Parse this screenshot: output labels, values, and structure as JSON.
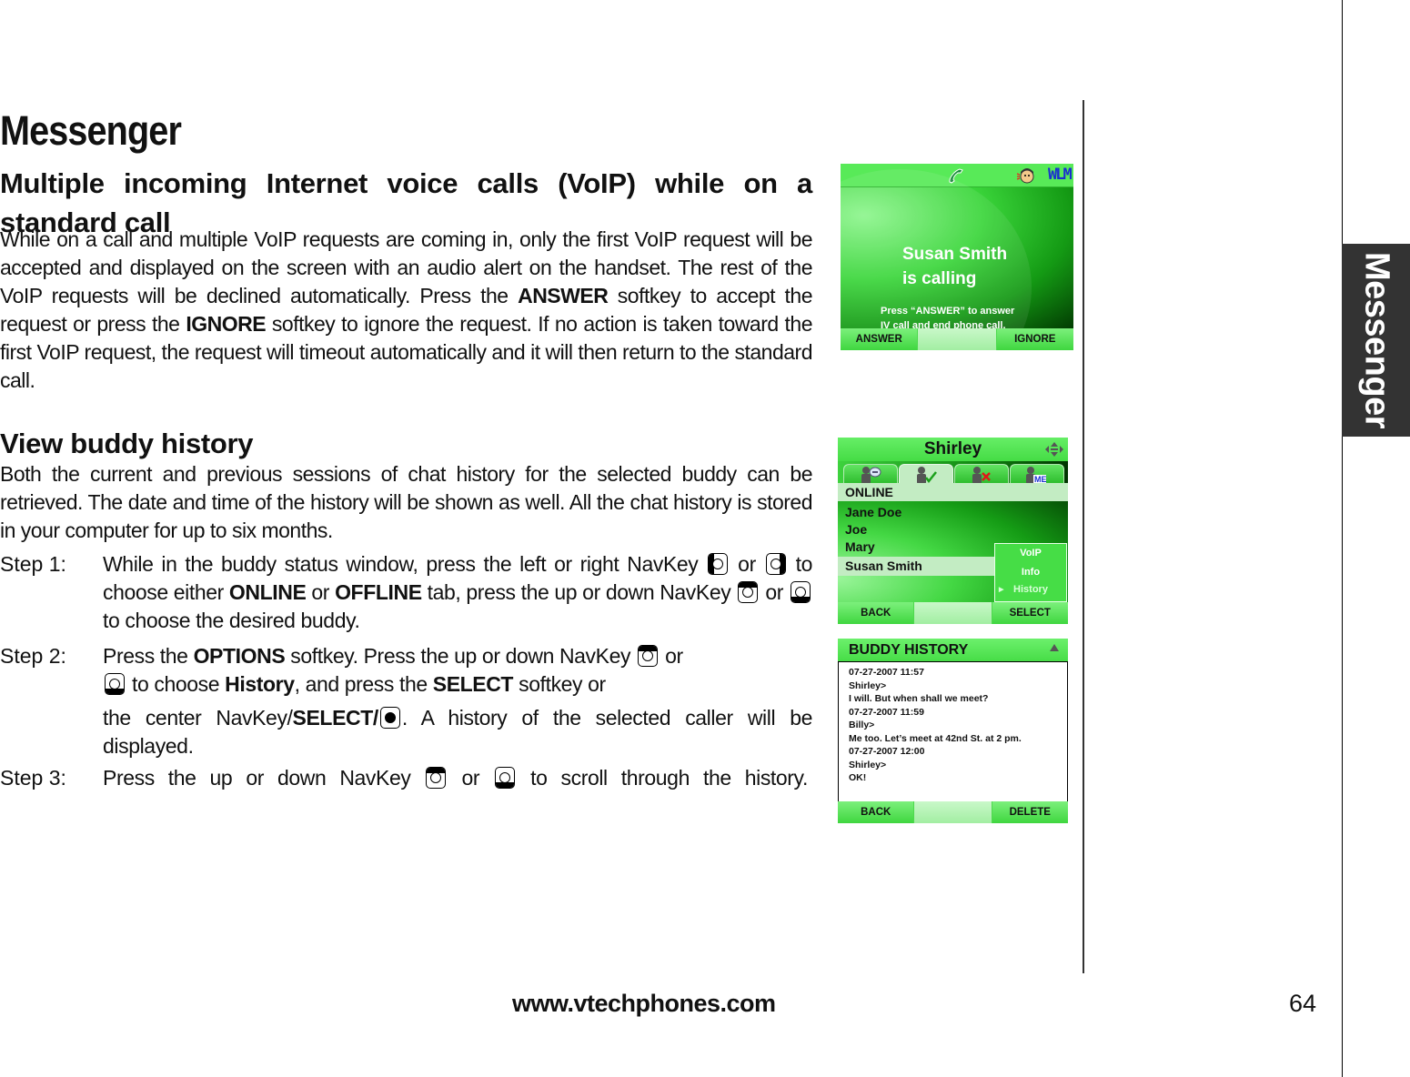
{
  "page": {
    "title": "Messenger",
    "side_tab": "Messenger",
    "footer_url": "www.vtechphones.com",
    "page_number": "64"
  },
  "section1": {
    "title": "Multiple incoming Internet voice calls (VoIP) while on a standard call",
    "para_parts": [
      "While on a call and multiple VoIP requests are coming in, only the first VoIP request will be accepted and displayed on the screen with an audio alert on the handset. The rest of the VoIP requests will be declined automatically. Press the ",
      "ANSWER",
      " softkey to accept the request or press the ",
      "IGNORE",
      " softkey to ignore the request. If no action is taken toward the first VoIP request, the request will timeout automatically and it will then return to the standard call."
    ]
  },
  "section2": {
    "title": "View buddy history",
    "para": "Both the current and previous sessions of chat history for the selected buddy can be retrieved. The date and time of the history will be shown as well. All the chat history is stored in your computer for up to six months.",
    "steps": [
      {
        "label": "Step 1:",
        "t1": "While in the buddy status window, press the left or right NavKey",
        "t2": "or",
        "t3": "to choose either",
        "b1": "ONLINE",
        "t4": "or",
        "b2": "OFFLINE",
        "t5": "tab, press the up or down NavKey",
        "t6": "or",
        "t7": "to choose the desired buddy."
      },
      {
        "label": "Step 2:",
        "t1": "Press the",
        "b1": "OPTIONS",
        "t2": "softkey. Press the up or down NavKey",
        "t3": "or",
        "t4": "to choose",
        "b2": "History",
        "t5": ", and press the",
        "b3": "SELECT",
        "t6": "softkey or",
        "t7": "the center NavKey/",
        "b4": "SELECT/",
        "t8": ". A history of the selected caller will be displayed."
      },
      {
        "label": "Step 3:",
        "t1": "Press the up or down NavKey",
        "t2": "or",
        "t3": "to scroll through the history."
      }
    ]
  },
  "screen_call": {
    "status_icons": [
      "phone-icon",
      "face-icon",
      "wlm-icon"
    ],
    "wlm_label": "WLM",
    "caller_line1": "Susan Smith",
    "caller_line2": "is calling",
    "hint_line1": "Press “ANSWER” to answer",
    "hint_line2": "IV call and end phone call.",
    "softkey_left": "ANSWER",
    "softkey_right": "IGNORE"
  },
  "screen_buddies": {
    "title": "Shirley",
    "tabs": [
      "chat-buddy-icon",
      "online-buddy-icon",
      "offline-buddy-icon",
      "me-icon"
    ],
    "active_tab": 1,
    "me_label": "ME",
    "section": "ONLINE",
    "buddies": [
      "Jane Doe",
      "Joe",
      "Mary",
      "Susan Smith"
    ],
    "selected_buddy": "Susan Smith",
    "menu": [
      "VoIP",
      "Info",
      "History"
    ],
    "menu_selected": "History",
    "softkey_left": "BACK",
    "softkey_right": "SELECT"
  },
  "screen_history": {
    "title": "BUDDY HISTORY",
    "lines": [
      "07-27-2007 11:57",
      "Shirley>",
      "I will. But when shall we meet?",
      "07-27-2007 11:59",
      "Billy>",
      "Me too. Let’s meet at 42nd St. at 2 pm.",
      "07-27-2007 12:00",
      "Shirley>",
      "OK!"
    ],
    "softkey_left": "BACK",
    "softkey_right": "DELETE"
  },
  "colors": {
    "screen_green": "#45dc45",
    "highlight": "#c3ecc3",
    "side_tab": "#333333"
  }
}
